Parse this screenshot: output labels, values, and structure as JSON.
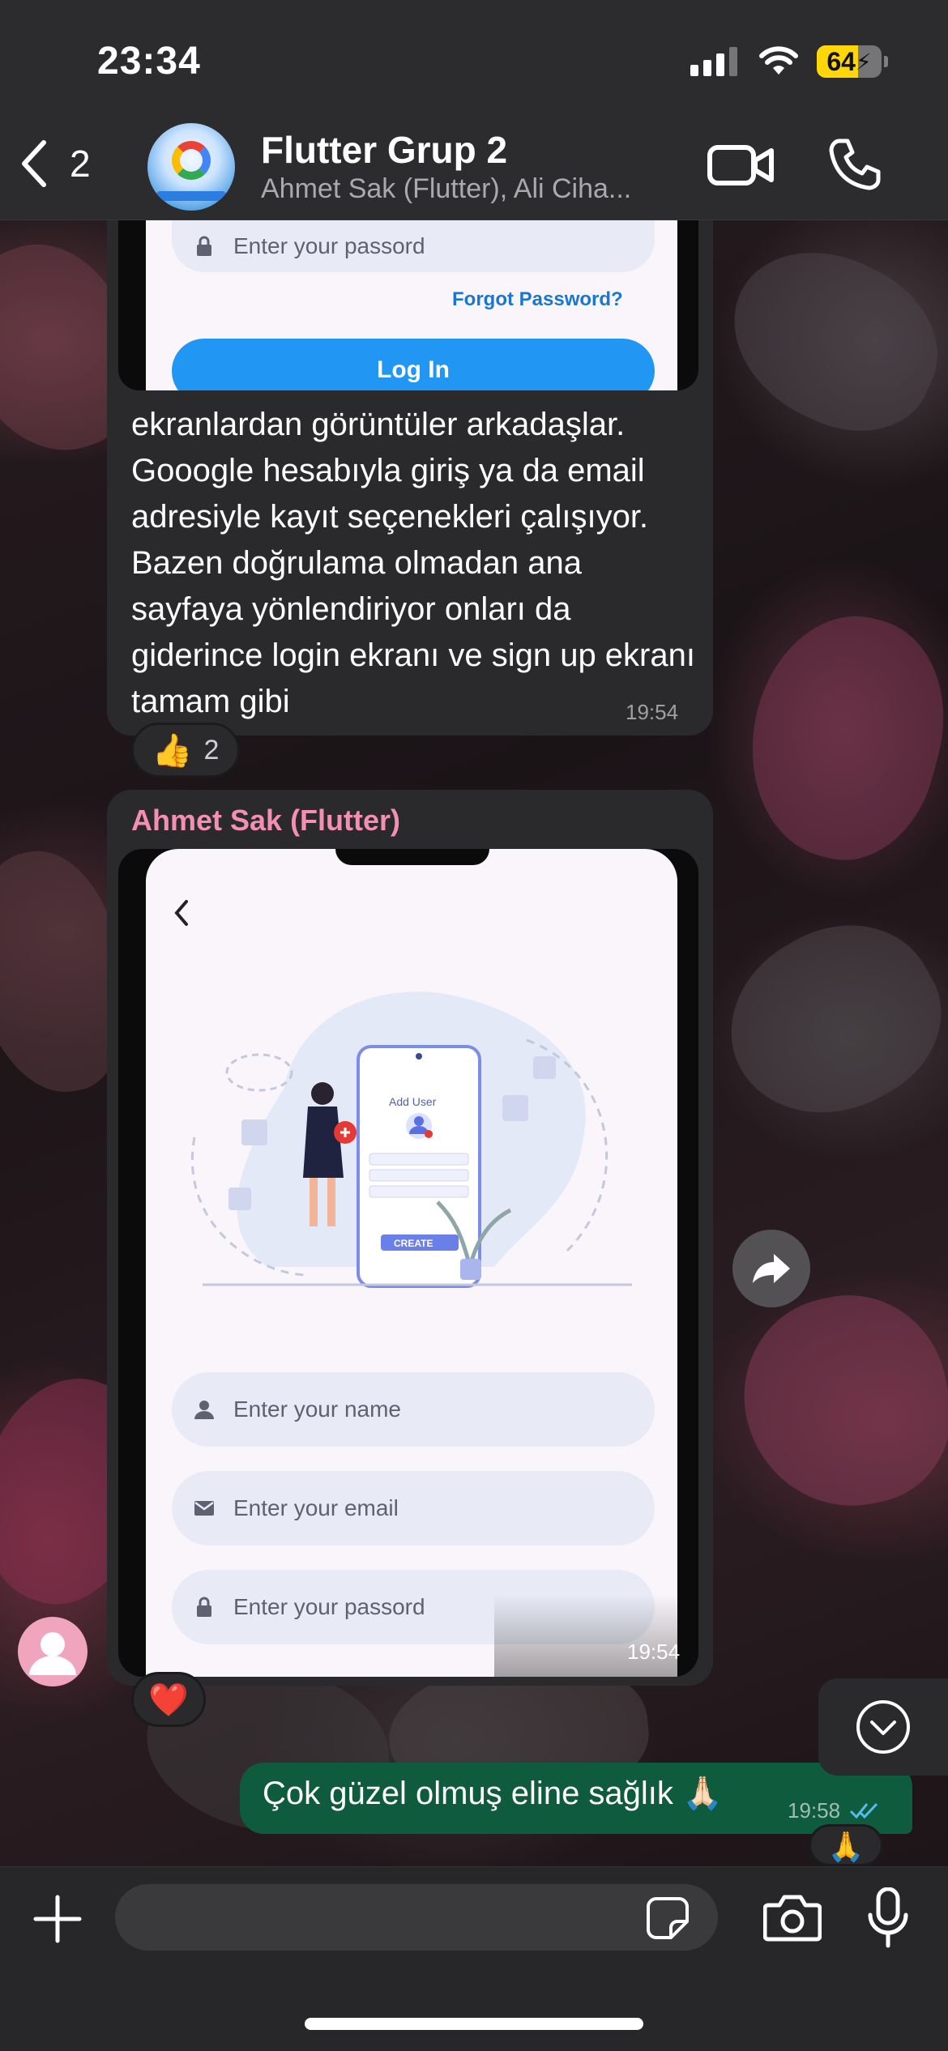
{
  "status_bar": {
    "time": "23:34",
    "battery_percent": "64",
    "battery_level": 0.64,
    "charging_icon": "bolt-icon"
  },
  "header": {
    "back_count": "2",
    "title": "Flutter Grup 2",
    "subtitle": "Ahmet Sak (Flutter), Ali Ciha...",
    "icons": [
      "chevron-left-icon",
      "video-call-icon",
      "phone-call-icon"
    ]
  },
  "messages": [
    {
      "type": "image_with_caption",
      "image_screen": {
        "password_placeholder": "Enter your passord",
        "forgot_label": "Forgot Password?",
        "login_label": "Log In"
      },
      "caption": "ekranlardan görüntüler arkadaşlar. Gooogle hesabıyla giriş ya da email adresiyle kayıt seçenekleri çalışıyor. Bazen doğrulama olmadan ana sayfaya yönlendiriyor onları da giderince login ekranı ve sign up ekranı tamam gibi",
      "time": "19:54",
      "reaction": {
        "emoji": "👍",
        "count": "2"
      }
    },
    {
      "type": "image",
      "sender": "Ahmet Sak (Flutter)",
      "image_screen": {
        "illustration_title": "Add User",
        "illustration_button": "CREATE",
        "name_placeholder": "Enter your name",
        "email_placeholder": "Enter your email",
        "password_placeholder": "Enter your passord"
      },
      "time": "19:54",
      "reaction": {
        "emoji": "❤️"
      }
    },
    {
      "type": "outgoing",
      "text": "Çok güzel olmuş eline sağlık 🙏🏻",
      "time": "19:58",
      "status_icon": "double-check-icon",
      "reaction": {
        "emoji": "🙏"
      }
    }
  ],
  "input": {
    "placeholder": ""
  },
  "colors": {
    "outgoing_bubble": "#0f5b3d",
    "incoming_bubble": "#2a2a2c",
    "sender_name": "#f48fb1",
    "read_ticks": "#53bdeb",
    "login_button": "#2196f3"
  }
}
